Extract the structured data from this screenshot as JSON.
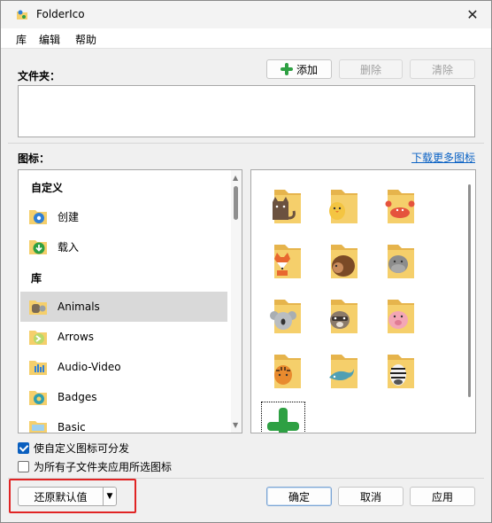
{
  "window": {
    "title": "FolderIco",
    "close_icon": "close-icon",
    "app_icon": "folderico-app-icon"
  },
  "menu": {
    "items": [
      "库",
      "编辑",
      "帮助"
    ]
  },
  "folders": {
    "label": "文件夹：",
    "add_label": "添加",
    "delete_label": "删除",
    "clear_label": "清除"
  },
  "icons": {
    "label": "图标：",
    "download_link": "下载更多图标",
    "custom_section": "自定义",
    "library_section": "库",
    "custom_items": [
      {
        "label": "创建",
        "icon": "gear-folder-icon"
      },
      {
        "label": "载入",
        "icon": "download-folder-icon"
      }
    ],
    "library_items": [
      {
        "label": "Animals",
        "icon": "animals-folder-icon",
        "selected": true
      },
      {
        "label": "Arrows",
        "icon": "arrows-folder-icon",
        "selected": false
      },
      {
        "label": "Audio-Video",
        "icon": "audio-video-folder-icon",
        "selected": false
      },
      {
        "label": "Badges",
        "icon": "badges-folder-icon",
        "selected": false
      },
      {
        "label": "Basic",
        "icon": "basic-folder-icon",
        "selected": false
      }
    ],
    "grid": [
      {
        "name": "cat-folder-icon",
        "animal": "cat"
      },
      {
        "name": "chick-folder-icon",
        "animal": "chick"
      },
      {
        "name": "crab-folder-icon",
        "animal": "crab"
      },
      {
        "name": "fox-folder-icon",
        "animal": "fox"
      },
      {
        "name": "hedgehog-folder-icon",
        "animal": "hedgehog"
      },
      {
        "name": "hippo-folder-icon",
        "animal": "hippo"
      },
      {
        "name": "koala-folder-icon",
        "animal": "koala"
      },
      {
        "name": "raccoon-folder-icon",
        "animal": "raccoon"
      },
      {
        "name": "pig-folder-icon",
        "animal": "pig"
      },
      {
        "name": "tiger-folder-icon",
        "animal": "tiger"
      },
      {
        "name": "whale-folder-icon",
        "animal": "whale"
      },
      {
        "name": "zebra-folder-icon",
        "animal": "zebra"
      },
      {
        "name": "add-icon",
        "animal": "plus"
      }
    ]
  },
  "options": {
    "distributable_label": "使自定义图标可分发",
    "distributable_checked": true,
    "apply_subfolders_label": "为所有子文件夹应用所选图标",
    "apply_subfolders_checked": false
  },
  "footer": {
    "restore_label": "还原默认值",
    "ok_label": "确定",
    "cancel_label": "取消",
    "apply_label": "应用"
  },
  "colors": {
    "folder": "#f5cf6b",
    "folder_dark": "#e6b44c",
    "accent_green": "#2ea043",
    "link": "#0b62c4",
    "highlight": "#e02424"
  }
}
